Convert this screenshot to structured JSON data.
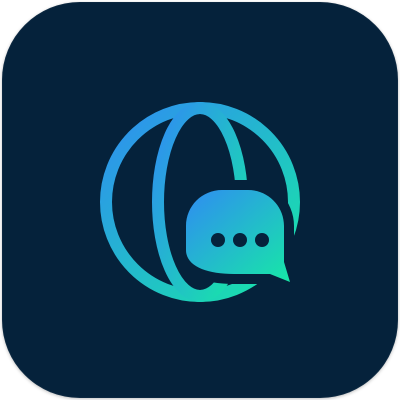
{
  "app_icon": {
    "icon": "globe-chat-icon",
    "colors": {
      "tile_background": "#05223b",
      "gradient_start": "#2f8cf2",
      "gradient_end": "#17e8a6"
    }
  }
}
